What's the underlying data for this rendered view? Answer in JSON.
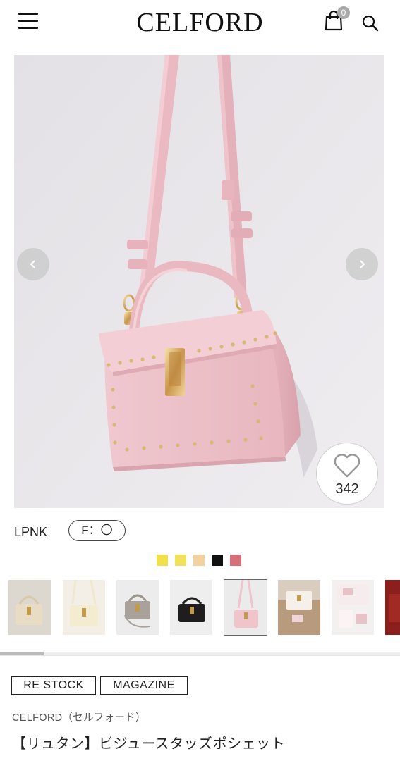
{
  "header": {
    "logo": "CELFORD",
    "cart_count": "0"
  },
  "product": {
    "favorite_count": "342",
    "color_code": "LPNK",
    "size_label": "F：〇",
    "swatches": [
      "#f2e04a",
      "#f0e25a",
      "#f3d29d",
      "#111111",
      "#d96f7a"
    ],
    "tags": [
      "RE STOCK",
      "MAGAZINE"
    ],
    "brand": "CELFORD（セルフォード）",
    "name": "【リュタン】ビジュースタッズポシェット"
  },
  "icons": {
    "menu": "hamburger-menu-icon",
    "cart": "shopping-bag-icon",
    "search": "search-icon",
    "prev": "chevron-left-icon",
    "next": "chevron-right-icon",
    "favorite": "heart-outline-icon"
  },
  "thumbnails": [
    {
      "name": "bag-beige-gold",
      "bg": "#dcd7cf",
      "bag": "#e8dcc4"
    },
    {
      "name": "bag-ivory",
      "bg": "#f3efe7",
      "bag": "#f4ecd0"
    },
    {
      "name": "bag-grey",
      "bg": "#ececec",
      "bag": "#a8a29b"
    },
    {
      "name": "bag-black",
      "bg": "#eeeeee",
      "bag": "#1e1e1e"
    },
    {
      "name": "bag-light-pink",
      "bg": "#ecebec",
      "bag": "#efc4cb"
    },
    {
      "name": "bag-lifestyle-table",
      "bg": "#b89a7c",
      "bag": "#f5f0ea"
    },
    {
      "name": "bag-packaging",
      "bg": "#f3f1ef",
      "bag": "#e7c2c8"
    },
    {
      "name": "bag-red",
      "bg": "#8b1f1d",
      "bag": "#a22a25"
    }
  ],
  "active_thumbnail_index": 4
}
